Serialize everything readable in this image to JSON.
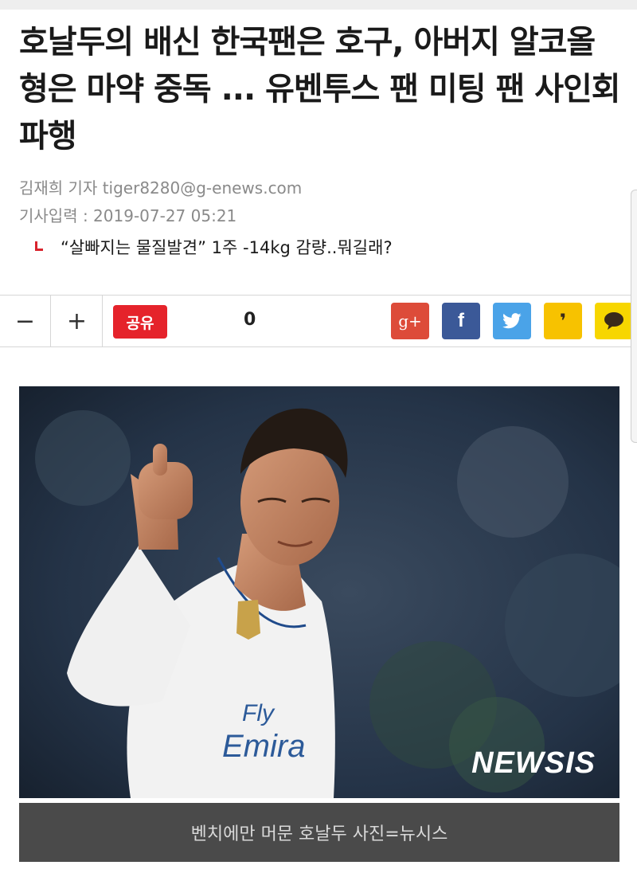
{
  "article": {
    "headline": "호날두의 배신 한국팬은 호구, 아버지 알코올 형은 마약 중독 ... 유벤투스 팬 미팅 팬 사인회 파행",
    "byline": "김재희 기자 tiger8280@g-enews.com",
    "dateline": "기사입력 : 2019-07-27 05:21",
    "related_link": "“살빠지는 물질발견” 1주 -14kg 감량..뭐길래?"
  },
  "toolbar": {
    "font_decrease": "−",
    "font_increase": "+",
    "share_label": "공유",
    "share_count": "0",
    "sns": [
      {
        "name": "google-plus",
        "glyph": "g+",
        "color": "#dd4b39"
      },
      {
        "name": "facebook",
        "glyph": "f",
        "color": "#3b5998"
      },
      {
        "name": "twitter",
        "glyph": "twitter-bird",
        "color": "#4aa3e8"
      },
      {
        "name": "kakaostory",
        "glyph": "❜",
        "color": "#f7c200"
      },
      {
        "name": "kakaotalk",
        "glyph": "speech-bubble",
        "color": "#f7d600"
      }
    ]
  },
  "photo": {
    "watermark": "NEWSIS",
    "jersey_text": "Fly Emirates",
    "caption": "벤치에만 머문 호날두 사진=뉴시스"
  },
  "colors": {
    "accent_red": "#e5232b",
    "caption_bg": "#4a4a4a"
  }
}
